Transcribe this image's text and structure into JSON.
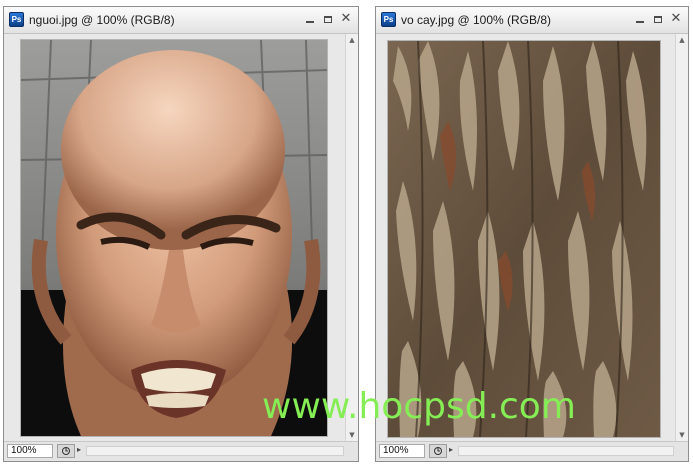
{
  "documents": [
    {
      "app_icon_label": "Ps",
      "title": "nguoi.jpg @ 100% (RGB/8)",
      "zoom": "100%"
    },
    {
      "app_icon_label": "Ps",
      "title": "vo cay.jpg @ 100% (RGB/8)",
      "zoom": "100%"
    }
  ],
  "watermark": "www.hocpsd.com",
  "colors": {
    "watermark": "#86ee55",
    "ps_icon": "#1f63c4",
    "window_chrome": "#e8e8e8"
  },
  "icons": {
    "app": "photoshop-icon",
    "minimize": "minimize-icon",
    "maximize": "maximize-icon",
    "close": "close-icon",
    "status_menu": "status-menu-icon"
  }
}
